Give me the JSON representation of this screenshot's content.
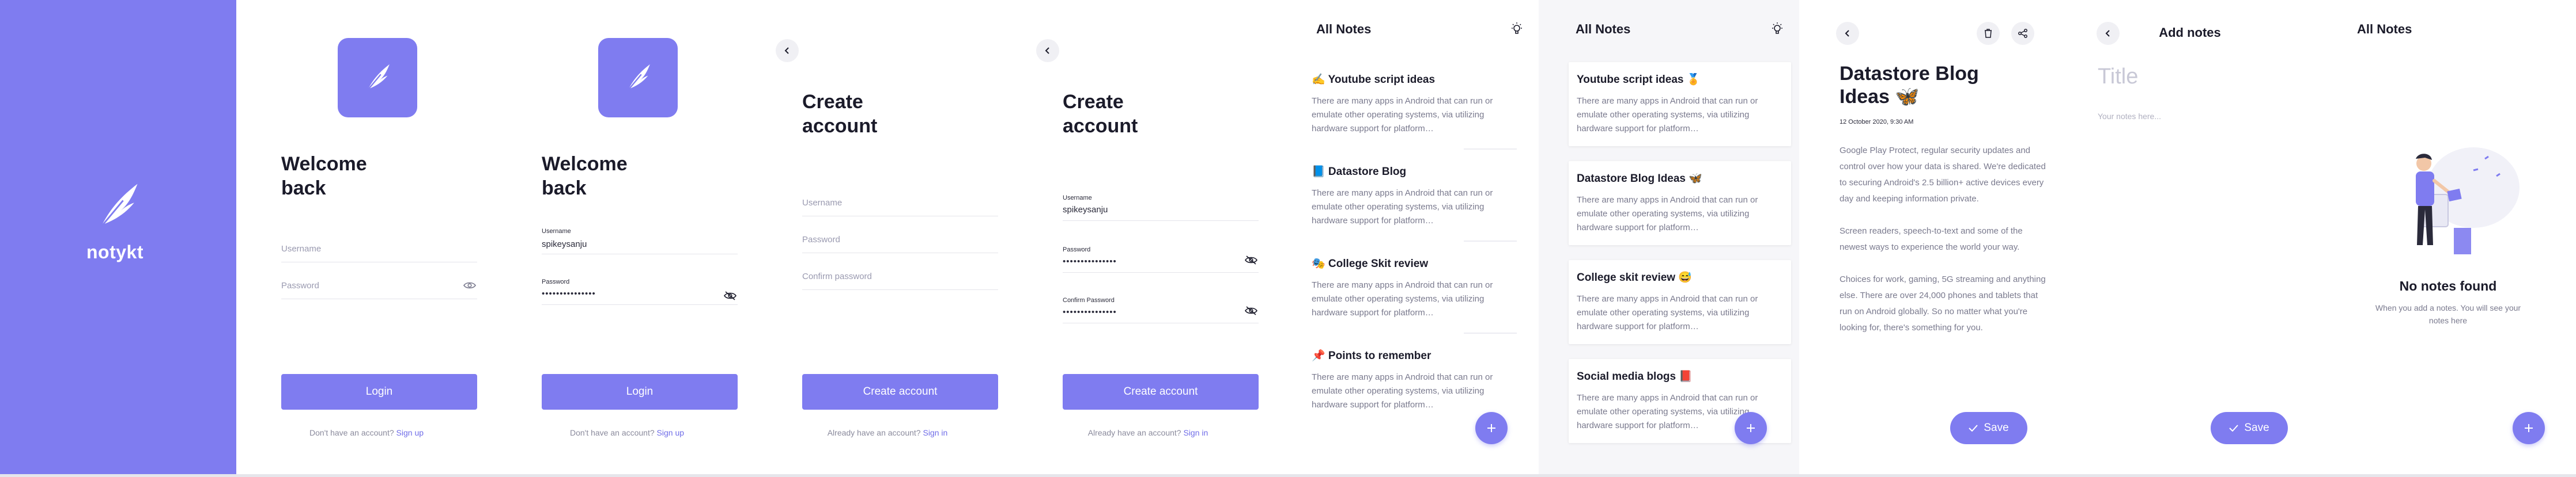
{
  "splash": {
    "brand": "notykt"
  },
  "login_empty": {
    "headline": "Welcome\nback",
    "username_placeholder": "Username",
    "password_placeholder": "Password",
    "button": "Login",
    "footer_prefix": "Don't have an account?",
    "footer_link": "Sign up"
  },
  "login_filled": {
    "headline": "Welcome\nback",
    "username_label": "Username",
    "username_value": "spikeysanju",
    "password_label": "Password",
    "password_value": "•••••••••••••••",
    "button": "Login",
    "footer_prefix": "Don't have an account?",
    "footer_link": "Sign up"
  },
  "signup_empty": {
    "headline": "Create\naccount",
    "username_placeholder": "Username",
    "password_placeholder": "Password",
    "confirm_placeholder": "Confirm password",
    "button": "Create account",
    "footer_prefix": "Already have an account?",
    "footer_link": "Sign in"
  },
  "signup_filled": {
    "headline": "Create\naccount",
    "username_label": "Username",
    "username_value": "spikeysanju",
    "password_label": "Password",
    "password_value": "•••••••••••••••",
    "confirm_label": "Confirm Password",
    "confirm_value": "•••••••••••••••",
    "button": "Create account",
    "footer_prefix": "Already have an account?",
    "footer_link": "Sign in"
  },
  "notes_list_a": {
    "title": "All Notes",
    "notes": [
      {
        "title": "✍️ Youtube script ideas",
        "body": "There are many apps in Android that can run or emulate other operating systems, via utilizing hardware support for platform…"
      },
      {
        "title": "📘 Datastore Blog",
        "body": "There are many apps in Android that can run or emulate other operating systems, via utilizing hardware support for platform…"
      },
      {
        "title": "🎭 College Skit review",
        "body": "There are many apps in Android that can run or emulate other operating systems, via utilizing hardware support for platform…"
      },
      {
        "title": "📌 Points to remember",
        "body": "There are many apps in Android that can run or emulate other operating systems, via utilizing hardware support for platform…"
      }
    ]
  },
  "notes_list_b": {
    "title": "All Notes",
    "notes": [
      {
        "title": "Youtube script ideas 🏅",
        "body": "There are many apps in Android that can run or emulate other operating systems, via utilizing hardware support for platform…"
      },
      {
        "title": "Datastore Blog Ideas 🦋",
        "body": "There are many apps in Android that can run or emulate other operating systems, via utilizing hardware support for platform…"
      },
      {
        "title": "College skit review 😅",
        "body": "There are many apps in Android that can run or emulate other operating systems, via utilizing hardware support for platform…"
      },
      {
        "title": "Social media blogs 📕",
        "body": "There are many apps in Android that can run or emulate other operating systems, via utilizing hardware support for platform…"
      }
    ]
  },
  "note_detail": {
    "title": "Datastore Blog\nIdeas 🦋",
    "date": "12 October 2020, 9:30 AM",
    "paragraphs": [
      "Google Play Protect, regular security updates and control over how your data is shared. We're dedicated to securing Android's 2.5 billion+ active devices every day and keeping information private.",
      "Screen readers, speech-to-text and some of the newest ways to experience the world your way.",
      "Choices for work, gaming, 5G streaming and anything else. There are over 24,000 phones and tablets that run on Android globally. So no matter what you're looking for, there's something for you."
    ],
    "save": "Save"
  },
  "add_note": {
    "title": "Add notes",
    "title_placeholder": "Title",
    "body_placeholder": "Your notes here...",
    "save": "Save"
  },
  "empty_state": {
    "title": "All Notes",
    "empty_title": "No notes found",
    "empty_sub": "When you add a notes. You will see your notes here"
  },
  "colors": {
    "primary": "#7f7cf0",
    "text": "#1b1b2a",
    "muted": "#7a7a8e"
  },
  "icons": [
    "feather-icon",
    "eye-icon",
    "eye-off-icon",
    "chevron-left-icon",
    "bulb-icon",
    "plus-icon",
    "trash-icon",
    "share-icon",
    "check-icon"
  ]
}
